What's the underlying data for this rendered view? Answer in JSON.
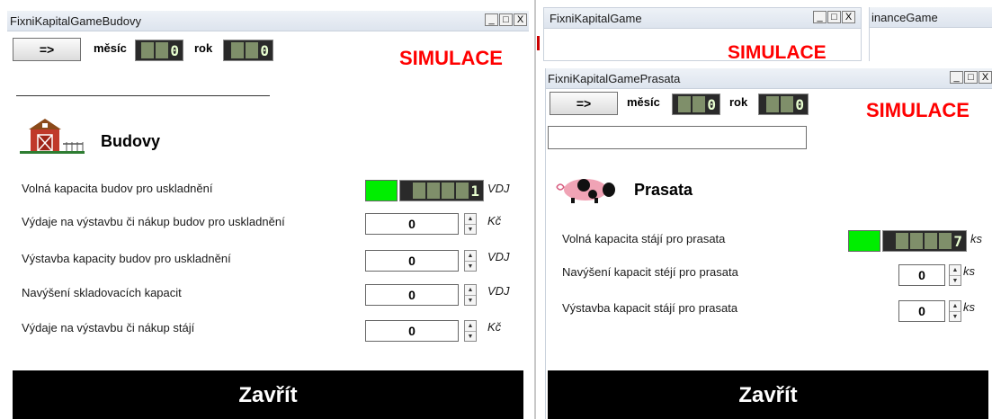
{
  "budovy_window": {
    "title": "FixniKapitalGameBudovy",
    "arrow_button": "=>",
    "month_label": "měsíc",
    "month_value": "0",
    "year_label": "rok",
    "year_value": "0",
    "simulation_label": "SIMULACE",
    "section_title": "Budovy",
    "rows": [
      {
        "label": "Volná kapacita budov pro uskladnění",
        "value": "1",
        "unit": "VDJ",
        "kind": "display"
      },
      {
        "label": "Výdaje na výstavbu či nákup budov pro uskladnění",
        "value": "0",
        "unit": "Kč",
        "kind": "input"
      },
      {
        "label": "Výstavba kapacity budov pro uskladnění",
        "value": "0",
        "unit": "VDJ",
        "kind": "input"
      },
      {
        "label": "Navýšení skladovacích kapacit",
        "value": "0",
        "unit": "VDJ",
        "kind": "input"
      },
      {
        "label": "Výdaje na výstavbu či nákup stájí",
        "value": "0",
        "unit": "Kč",
        "kind": "input"
      }
    ],
    "close_label": "Zavřít",
    "icon": "barn-icon",
    "indicator_color": "#00ee00"
  },
  "back_window": {
    "title": "FixniKapitalGame",
    "simulation_label": "SIMULACE"
  },
  "far_window": {
    "title": "inanceGame"
  },
  "prasata_window": {
    "title": "FixniKapitalGamePrasata",
    "arrow_button": "=>",
    "month_label": "měsíc",
    "month_value": "0",
    "year_label": "rok",
    "year_value": "0",
    "simulation_label": "SIMULACE",
    "text_input_value": "",
    "section_title": "Prasata",
    "rows": [
      {
        "label": "Volná kapacita stájí pro prasata",
        "value": "7",
        "unit": "ks",
        "kind": "display"
      },
      {
        "label": "Navýšení kapacit stéjí pro prasata",
        "value": "0",
        "unit": "ks",
        "kind": "input"
      },
      {
        "label": "Výstavba kapacit stájí pro prasata",
        "value": "0",
        "unit": "ks",
        "kind": "input"
      }
    ],
    "close_label": "Zavřít",
    "icon": "pig-icon",
    "indicator_color": "#00ee00"
  },
  "window_controls": [
    "_",
    "□",
    "X"
  ]
}
